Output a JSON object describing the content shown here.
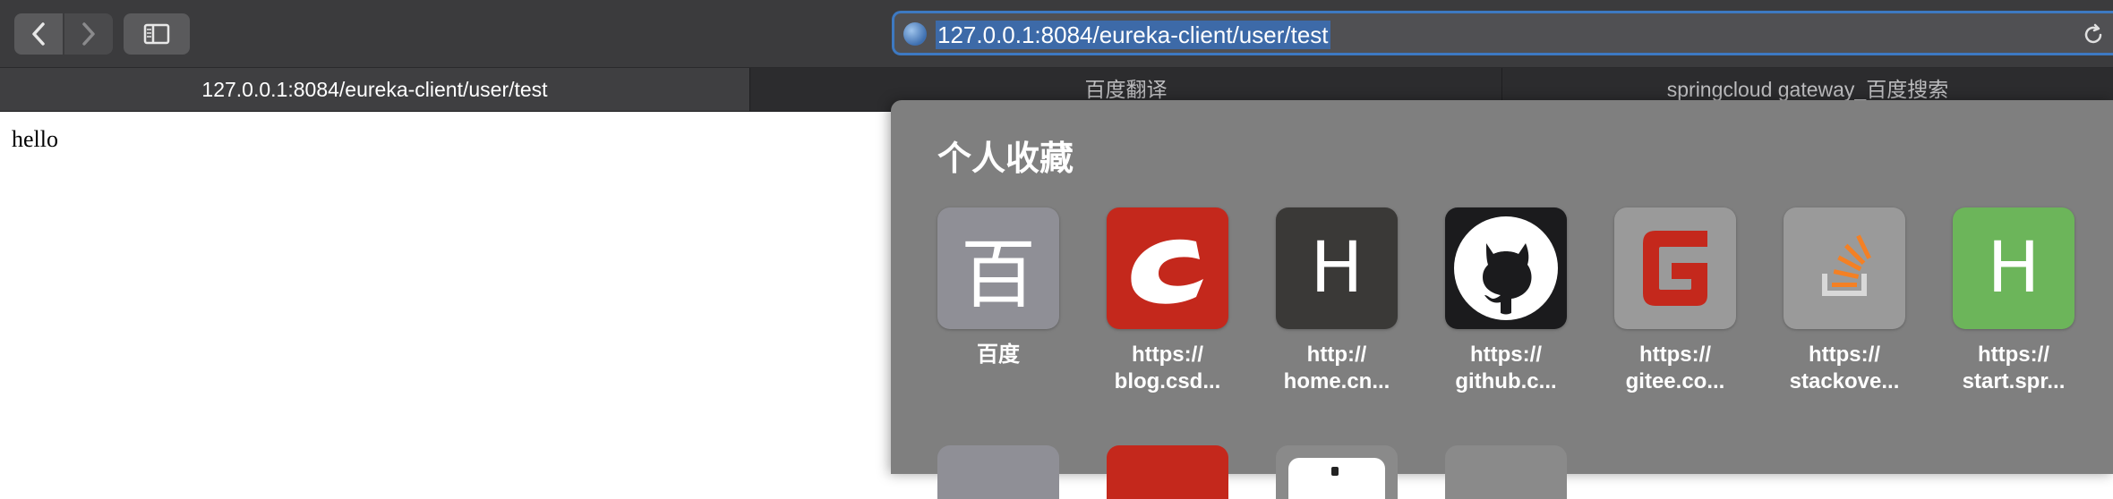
{
  "toolbar": {
    "address": "127.0.0.1:8084/eureka-client/user/test"
  },
  "tabs": [
    {
      "label": "127.0.0.1:8084/eureka-client/user/test",
      "active": true
    },
    {
      "label": "百度翻译",
      "active": false
    },
    {
      "label": "springcloud gateway_百度搜索",
      "active": false
    }
  ],
  "page": {
    "body_text": "hello"
  },
  "favorites": {
    "title": "个人收藏",
    "items": [
      {
        "glyph": "百",
        "label": "百度",
        "icon": "baidu-icon",
        "color": "#8f8f96"
      },
      {
        "glyph": "",
        "label": "https://\nblog.csd...",
        "icon": "csdn-icon",
        "color": "#c4281c"
      },
      {
        "glyph": "H",
        "label": "http://\nhome.cn...",
        "icon": "letter-h-icon",
        "color": "#3a3937"
      },
      {
        "glyph": "",
        "label": "https://\ngithub.c...",
        "icon": "github-icon",
        "color": "#1b1b1d"
      },
      {
        "glyph": "",
        "label": "https://\ngitee.co...",
        "icon": "gitee-icon",
        "color": "#9a9a9a"
      },
      {
        "glyph": "",
        "label": "https://\nstackove...",
        "icon": "stackoverflow-icon",
        "color": "#9a9a9a"
      },
      {
        "glyph": "H",
        "label": "https://\nstart.spr...",
        "icon": "letter-h-icon",
        "color": "#6cb55a"
      }
    ]
  }
}
